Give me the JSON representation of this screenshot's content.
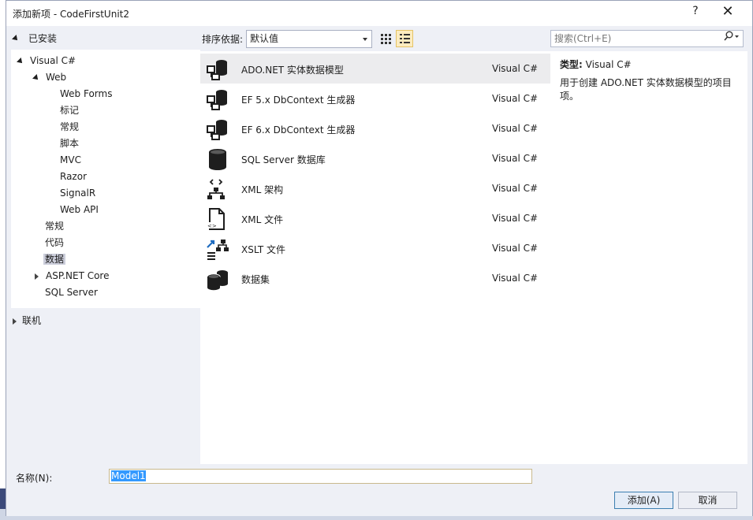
{
  "dialog": {
    "title": "添加新项 - CodeFirstUnit2",
    "help_label": "?",
    "close_label": "✕"
  },
  "tree": {
    "installed": "已安装",
    "items": [
      {
        "label": "Visual C#"
      },
      {
        "label": "Web"
      },
      {
        "label": "Web Forms"
      },
      {
        "label": "标记"
      },
      {
        "label": "常规"
      },
      {
        "label": "脚本"
      },
      {
        "label": "MVC"
      },
      {
        "label": "Razor"
      },
      {
        "label": "SignalR"
      },
      {
        "label": "Web API"
      },
      {
        "label": "常规"
      },
      {
        "label": "代码"
      },
      {
        "label": "数据"
      },
      {
        "label": "ASP.NET Core"
      },
      {
        "label": "SQL Server"
      }
    ],
    "online": "联机"
  },
  "sort": {
    "label": "排序依据:",
    "value": "默认值"
  },
  "search": {
    "placeholder": "搜索(Ctrl+E)"
  },
  "templates": [
    {
      "name": "ADO.NET 实体数据模型",
      "lang": "Visual C#",
      "icon": "ado-entity-model-icon"
    },
    {
      "name": "EF 5.x DbContext 生成器",
      "lang": "Visual C#",
      "icon": "ef5-dbcontext-icon"
    },
    {
      "name": "EF 6.x DbContext 生成器",
      "lang": "Visual C#",
      "icon": "ef6-dbcontext-icon"
    },
    {
      "name": "SQL Server 数据库",
      "lang": "Visual C#",
      "icon": "database-icon"
    },
    {
      "name": "XML 架构",
      "lang": "Visual C#",
      "icon": "xml-schema-icon"
    },
    {
      "name": "XML 文件",
      "lang": "Visual C#",
      "icon": "xml-file-icon"
    },
    {
      "name": "XSLT 文件",
      "lang": "Visual C#",
      "icon": "xslt-file-icon"
    },
    {
      "name": "数据集",
      "lang": "Visual C#",
      "icon": "dataset-icon"
    }
  ],
  "description": {
    "type_label": "类型:",
    "type_value": "Visual C#",
    "text": "用于创建 ADO.NET 实体数据模型的项目项。"
  },
  "name_field": {
    "label": "名称(N):",
    "value": "Model1"
  },
  "buttons": {
    "add": "添加(A)",
    "cancel": "取消"
  }
}
